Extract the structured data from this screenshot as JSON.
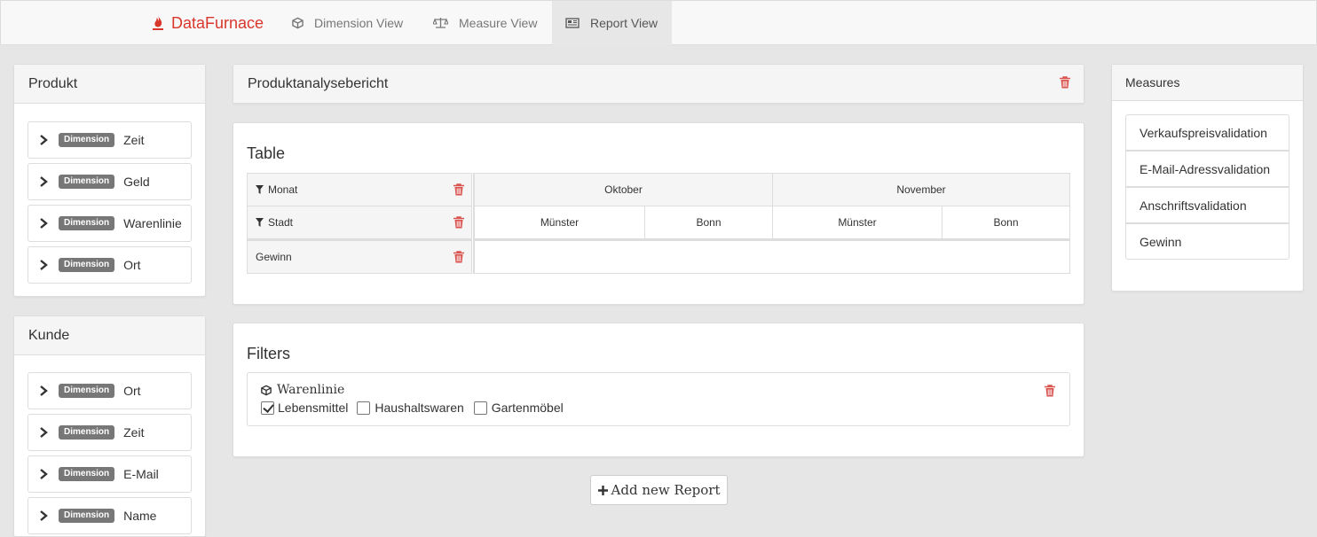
{
  "nav": {
    "brand": "DataFurnace",
    "tabs": [
      {
        "label": "Dimension View",
        "icon": "cube-icon"
      },
      {
        "label": "Measure View",
        "icon": "balance-scale-icon"
      },
      {
        "label": "Report View",
        "icon": "newspaper-icon",
        "active": true
      }
    ]
  },
  "left_panels": [
    {
      "title": "Produkt",
      "badge": "Dimension",
      "items": [
        "Zeit",
        "Geld",
        "Warenlinie",
        "Ort"
      ]
    },
    {
      "title": "Kunde",
      "badge": "Dimension",
      "items": [
        "Ort",
        "Zeit",
        "E-Mail",
        "Name"
      ]
    }
  ],
  "report": {
    "title": "Produktanalysebericht",
    "table": {
      "heading": "Table",
      "row_dims": [
        "Monat",
        "Stadt"
      ],
      "measure": "Gewinn",
      "months": [
        "Oktober",
        "November"
      ],
      "cities": [
        "Münster",
        "Bonn",
        "Münster",
        "Bonn"
      ]
    },
    "filters": {
      "heading": "Filters",
      "dimension": "Warenlinie",
      "options": [
        {
          "label": "Lebensmittel",
          "checked": true
        },
        {
          "label": "Haushaltswaren",
          "checked": false
        },
        {
          "label": "Gartenmöbel",
          "checked": false
        }
      ]
    },
    "add_button": "Add new Report"
  },
  "measures": {
    "title": "Measures",
    "items": [
      "Verkaufspreisvalidation",
      "E-Mail-Adressvalidation",
      "Anschriftsvalidation",
      "Gewinn"
    ]
  },
  "colors": {
    "brand": "#d9372b",
    "danger": "#d9534f",
    "badge": "#777777"
  }
}
